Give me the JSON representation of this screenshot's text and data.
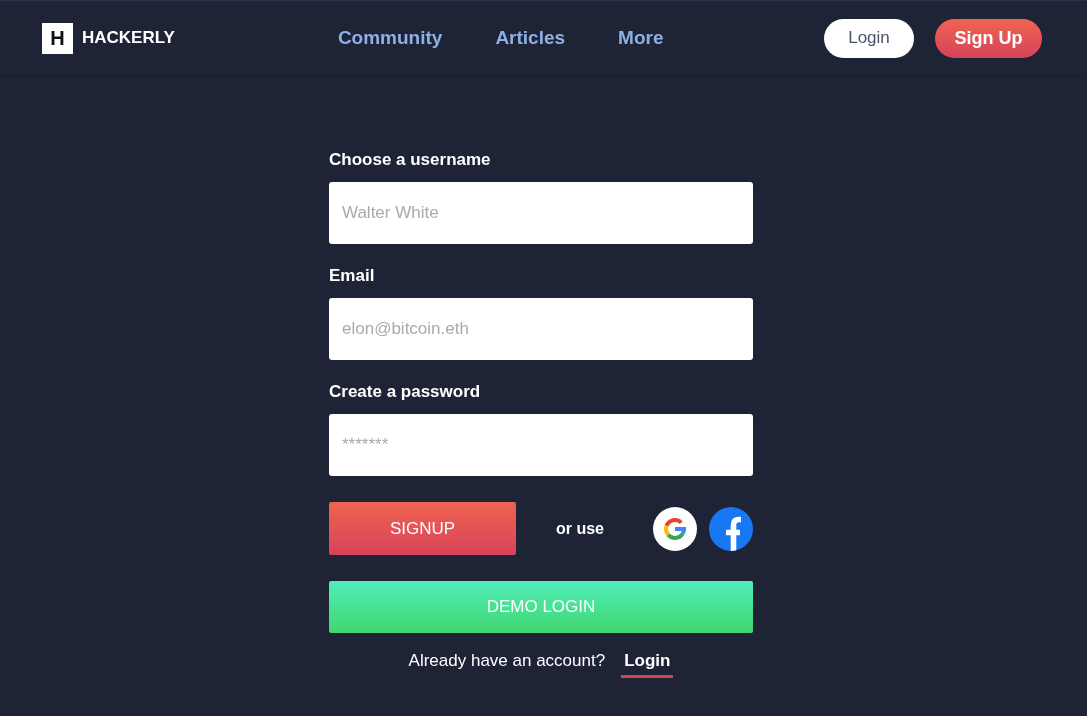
{
  "header": {
    "logo": {
      "mark": "H",
      "name": "HACKERLY"
    },
    "nav": [
      "Community",
      "Articles",
      "More"
    ],
    "buttons": [
      {
        "kind": "outline",
        "label": "Login"
      },
      {
        "kind": "filled",
        "label": "Sign Up"
      }
    ]
  },
  "form": {
    "fields": [
      {
        "label": "Choose a username",
        "placeholder": "Walter White"
      },
      {
        "label": "Email",
        "placeholder": "elon@bitcoin.eth"
      },
      {
        "label": "Create a password",
        "placeholder": "*******"
      }
    ],
    "signup_button": "SIGNUP",
    "alt_text": "or use",
    "social_buttons": [
      {
        "kind": "google"
      },
      {
        "kind": "facebook"
      }
    ],
    "demo_button": "DEMO LOGIN",
    "footer": {
      "text": "Already have an account?",
      "link": "Login"
    }
  }
}
